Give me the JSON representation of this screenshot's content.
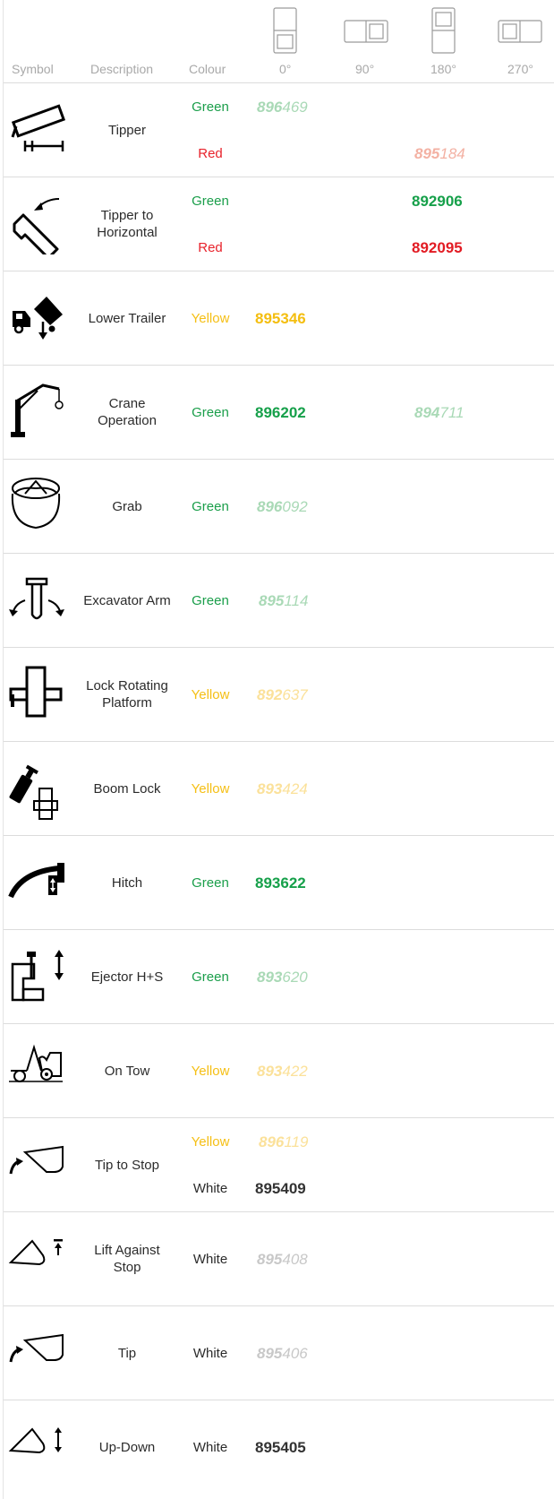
{
  "header": {
    "symbol": "Symbol",
    "description": "Description",
    "colour": "Colour",
    "orientations": [
      "0°",
      "90°",
      "180°",
      "270°"
    ]
  },
  "rows": [
    {
      "icon": "tipper-icon",
      "description": "Tipper",
      "entries": [
        {
          "colour": "Green",
          "code_lead": "896",
          "code_tail": "469",
          "column": "0°",
          "style": "faded"
        },
        {
          "colour": "Red",
          "code_lead": "895",
          "code_tail": "184",
          "column": "180°",
          "style": "faded"
        }
      ]
    },
    {
      "icon": "tipper-to-horizontal-icon",
      "description": "Tipper to Horizontal",
      "entries": [
        {
          "colour": "Green",
          "code_lead": "892",
          "code_tail": "906",
          "column": "180°",
          "style": "solid"
        },
        {
          "colour": "Red",
          "code_lead": "892",
          "code_tail": "095",
          "column": "180°",
          "style": "solid"
        }
      ]
    },
    {
      "icon": "lower-trailer-icon",
      "description": "Lower Trailer",
      "entries": [
        {
          "colour": "Yellow",
          "code_lead": "895",
          "code_tail": "346",
          "column": "0°",
          "style": "solid"
        }
      ]
    },
    {
      "icon": "crane-icon",
      "description": "Crane Operation",
      "entries": [
        {
          "colour": "Green",
          "code_lead": "896",
          "code_tail": "202",
          "column": "0°",
          "style": "solid"
        },
        {
          "colour": "",
          "code_lead": "894",
          "code_tail": "711",
          "column": "180°",
          "style": "faded",
          "tone": "Green"
        }
      ]
    },
    {
      "icon": "grab-icon",
      "description": "Grab",
      "entries": [
        {
          "colour": "Green",
          "code_lead": "896",
          "code_tail": "092",
          "column": "0°",
          "style": "faded"
        }
      ]
    },
    {
      "icon": "excavator-arm-icon",
      "description": "Excavator Arm",
      "entries": [
        {
          "colour": "Green",
          "code_lead": "895",
          "code_tail": "114",
          "column": "0°",
          "style": "faded"
        }
      ]
    },
    {
      "icon": "lock-rotating-platform-icon",
      "description": "Lock Rotating Platform",
      "entries": [
        {
          "colour": "Yellow",
          "code_lead": "892",
          "code_tail": "637",
          "column": "0°",
          "style": "faded"
        }
      ]
    },
    {
      "icon": "boom-lock-icon",
      "description": "Boom Lock",
      "entries": [
        {
          "colour": "Yellow",
          "code_lead": "893",
          "code_tail": "424",
          "column": "0°",
          "style": "faded"
        }
      ]
    },
    {
      "icon": "hitch-icon",
      "description": "Hitch",
      "entries": [
        {
          "colour": "Green",
          "code_lead": "893",
          "code_tail": "622",
          "column": "0°",
          "style": "solid"
        }
      ]
    },
    {
      "icon": "ejector-icon",
      "description": "Ejector H+S",
      "entries": [
        {
          "colour": "Green",
          "code_lead": "893",
          "code_tail": "620",
          "column": "0°",
          "style": "faded"
        }
      ]
    },
    {
      "icon": "on-tow-icon",
      "description": "On Tow",
      "entries": [
        {
          "colour": "Yellow",
          "code_lead": "893",
          "code_tail": "422",
          "column": "0°",
          "style": "faded"
        }
      ]
    },
    {
      "icon": "tip-to-stop-icon",
      "description": "Tip to Stop",
      "entries": [
        {
          "colour": "Yellow",
          "code_lead": "896",
          "code_tail": "119",
          "column": "0°",
          "style": "faded"
        },
        {
          "colour": "White",
          "code_lead": "895",
          "code_tail": "409",
          "column": "0°",
          "style": "solid"
        }
      ]
    },
    {
      "icon": "lift-against-stop-icon",
      "description": "Lift Against Stop",
      "entries": [
        {
          "colour": "White",
          "code_lead": "895",
          "code_tail": "408",
          "column": "0°",
          "style": "faded"
        }
      ]
    },
    {
      "icon": "tip-icon",
      "description": "Tip",
      "entries": [
        {
          "colour": "White",
          "code_lead": "895",
          "code_tail": "406",
          "column": "0°",
          "style": "faded"
        }
      ]
    },
    {
      "icon": "up-down-icon",
      "description": "Up-Down",
      "entries": [
        {
          "colour": "White",
          "code_lead": "895",
          "code_tail": "405",
          "column": "0°",
          "style": "solid"
        }
      ]
    }
  ],
  "colors": {
    "green": "#16a04a",
    "red": "#e21b23",
    "yellow": "#f4be10",
    "white_text": "#333333",
    "rule": "#dcdcdc"
  }
}
